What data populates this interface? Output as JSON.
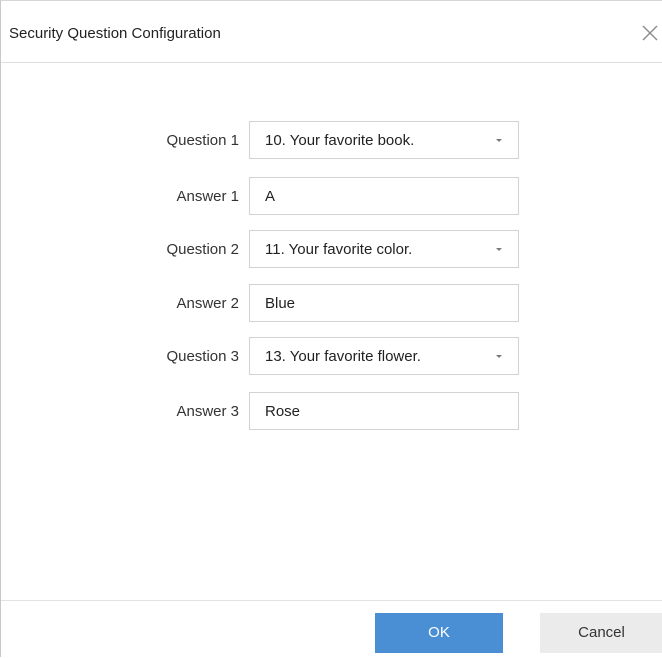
{
  "dialog": {
    "title": "Security Question Configuration",
    "close_icon": "close-icon"
  },
  "form": {
    "rows": [
      {
        "label": "Question 1",
        "type": "select",
        "value": "10. Your favorite book."
      },
      {
        "label": "Answer 1",
        "type": "text",
        "value": "A"
      },
      {
        "label": "Question 2",
        "type": "select",
        "value": "11. Your favorite color."
      },
      {
        "label": "Answer 2",
        "type": "text",
        "value": "Blue"
      },
      {
        "label": "Question 3",
        "type": "select",
        "value": "13. Your favorite flower."
      },
      {
        "label": "Answer 3",
        "type": "text",
        "value": "Rose"
      }
    ]
  },
  "footer": {
    "ok_label": "OK",
    "cancel_label": "Cancel"
  },
  "colors": {
    "primary_button": "#4a8fd4",
    "secondary_button": "#ebebeb",
    "field_border": "#d3d3d3"
  }
}
